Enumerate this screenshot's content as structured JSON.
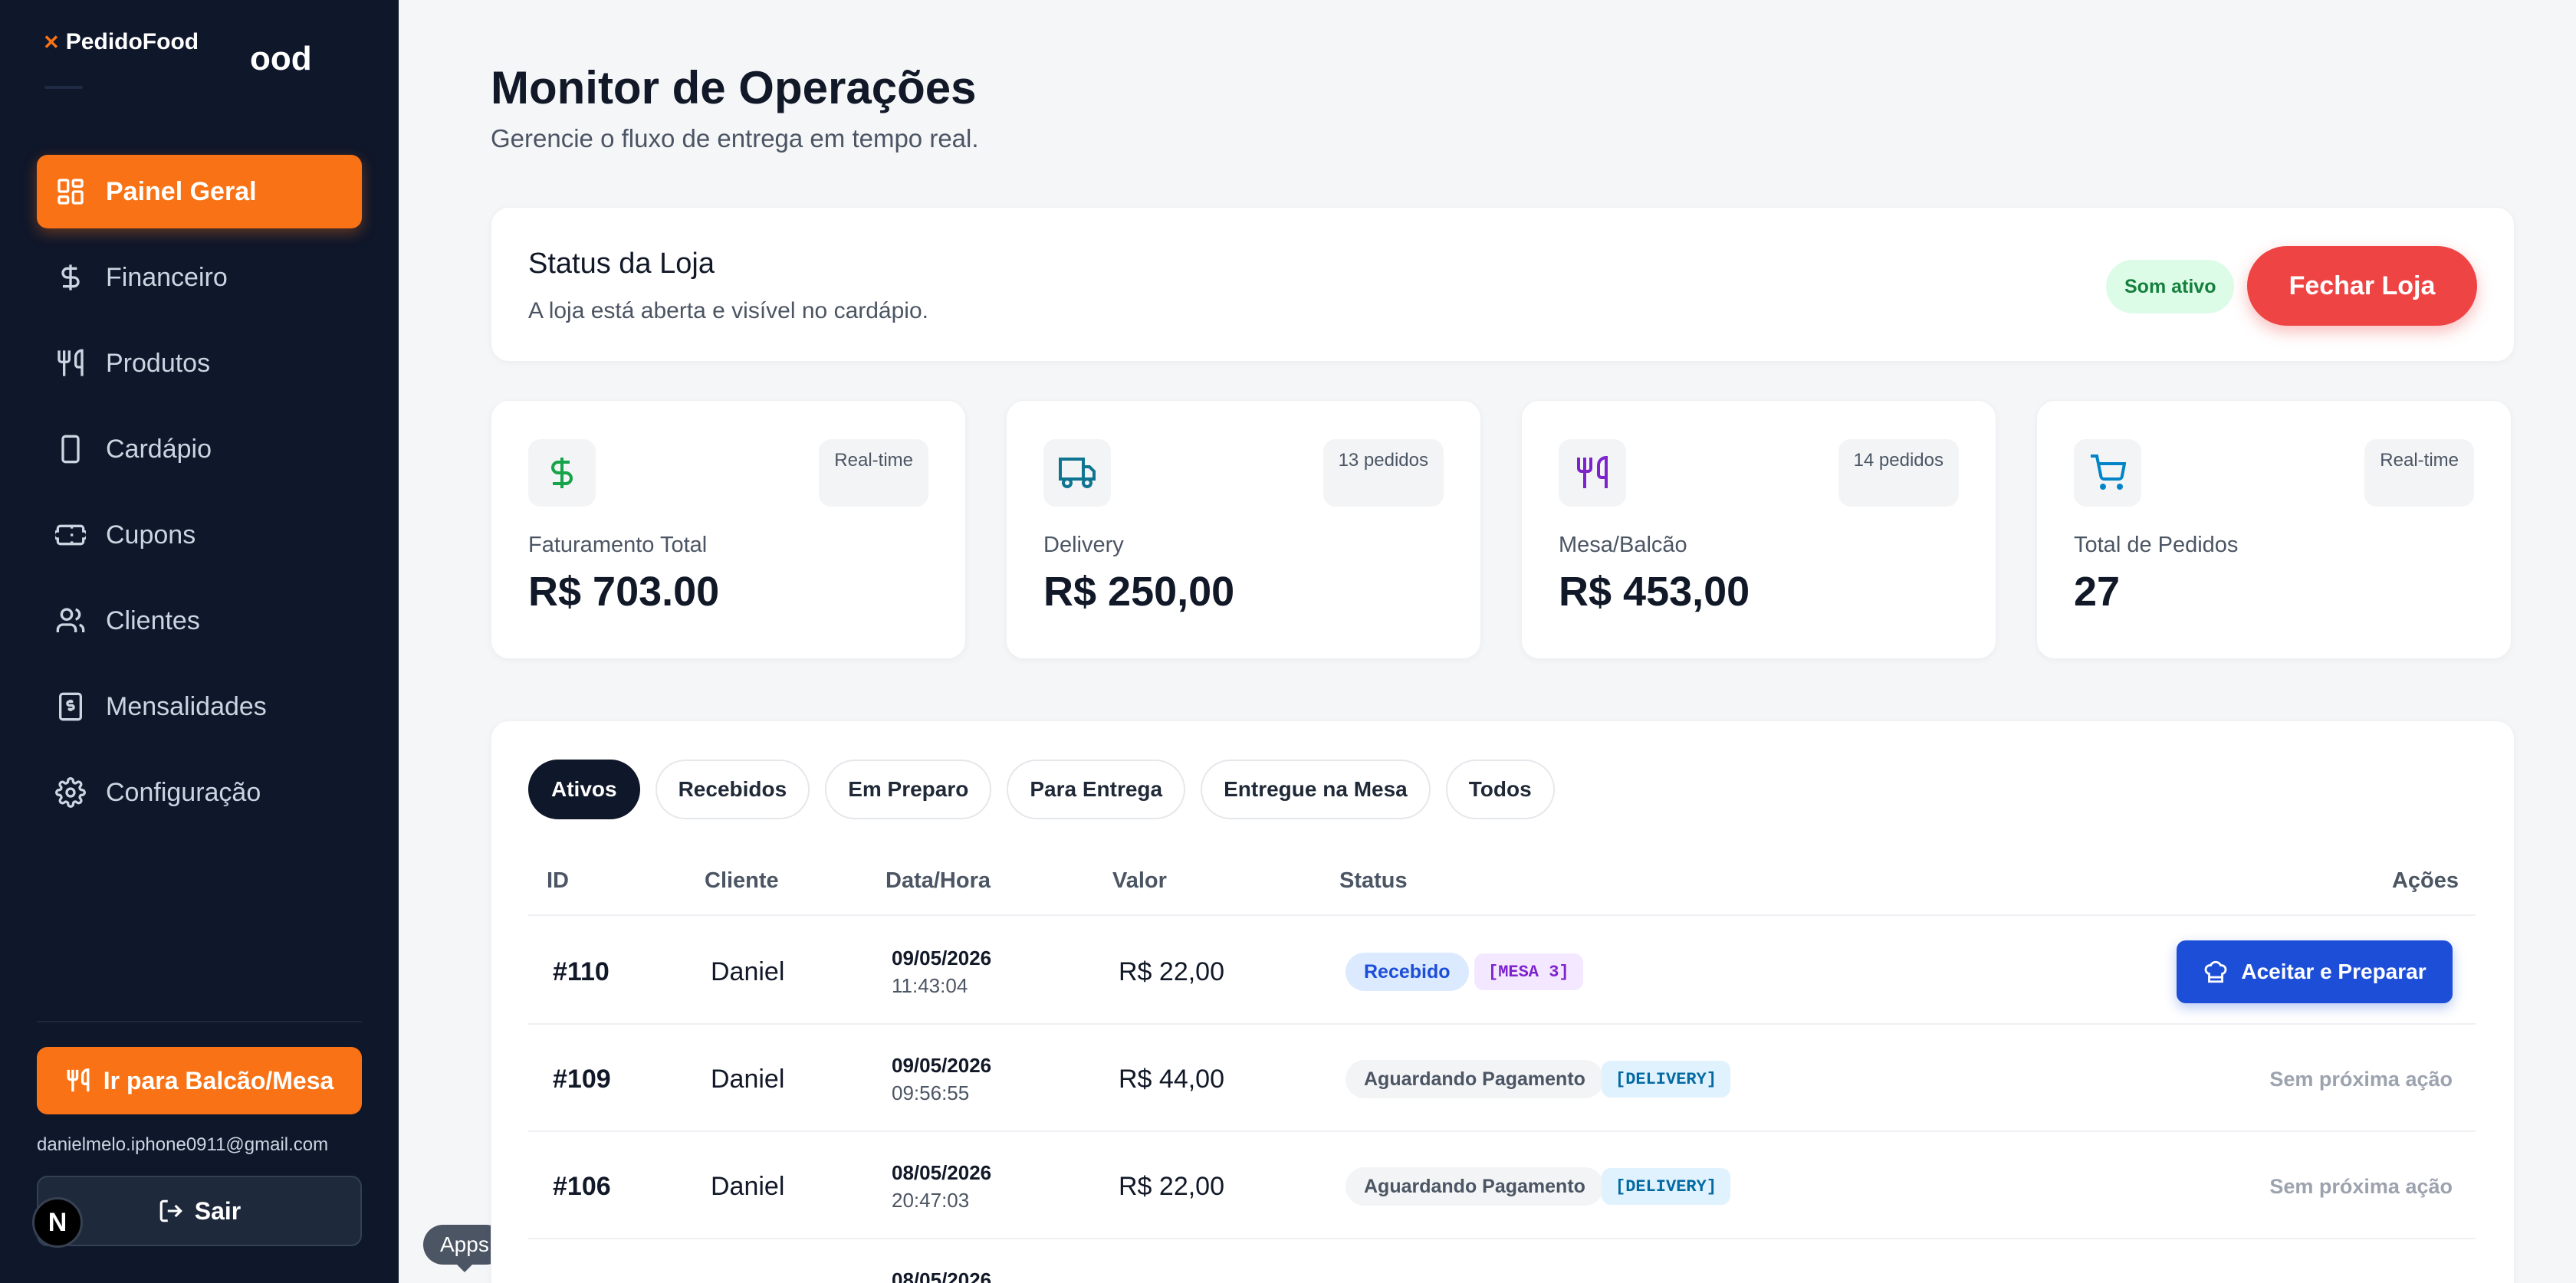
{
  "sidebar": {
    "brand": "PedidoFood",
    "brand_echo": "ood",
    "nav": [
      {
        "label": "Painel Geral",
        "icon": "dashboard-icon",
        "active": true
      },
      {
        "label": "Financeiro",
        "icon": "dollar-icon"
      },
      {
        "label": "Produtos",
        "icon": "utensils-icon"
      },
      {
        "label": "Cardápio",
        "icon": "phone-icon"
      },
      {
        "label": "Cupons",
        "icon": "ticket-icon"
      },
      {
        "label": "Clientes",
        "icon": "users-icon"
      },
      {
        "label": "Mensalidades",
        "icon": "receipt-icon"
      },
      {
        "label": "Configuração",
        "icon": "gear-icon"
      }
    ],
    "balcao_button": "Ir para Balcão/Mesa",
    "email": "danielmelo.iphone0911@gmail.com",
    "logout_button": "Sair",
    "n_badge": "N",
    "apps_tooltip": "Apps"
  },
  "header": {
    "title": "Monitor de Operações",
    "subtitle": "Gerencie o fluxo de entrega em tempo real."
  },
  "store_status": {
    "title": "Status da Loja",
    "description": "A loja está aberta e visível no cardápio.",
    "sound_badge": "Som ativo",
    "close_button": "Fechar Loja"
  },
  "stats": [
    {
      "label": "Faturamento Total",
      "value": "R$ 703.00",
      "badge": "Real-time",
      "icon": "dollar-icon"
    },
    {
      "label": "Delivery",
      "value": "R$ 250,00",
      "badge": "13 pedidos",
      "icon": "truck-icon"
    },
    {
      "label": "Mesa/Balcão",
      "value": "R$ 453,00",
      "badge": "14 pedidos",
      "icon": "utensils-icon"
    },
    {
      "label": "Total de Pedidos",
      "value": "27",
      "badge": "Real-time",
      "icon": "cart-icon"
    }
  ],
  "orders": {
    "tabs": [
      "Ativos",
      "Recebidos",
      "Em Preparo",
      "Para Entrega",
      "Entregue na Mesa",
      "Todos"
    ],
    "columns": [
      "ID",
      "Cliente",
      "Data/Hora",
      "Valor",
      "Status",
      "Ações"
    ],
    "rows": [
      {
        "id": "#110",
        "client": "Daniel",
        "date": "09/05/2026",
        "time": "11:43:04",
        "value": "R$ 22,00",
        "status": "Recebido",
        "tag": "[MESA 3]",
        "action": "Aceitar e Preparar"
      },
      {
        "id": "#109",
        "client": "Daniel",
        "date": "09/05/2026",
        "time": "09:56:55",
        "value": "R$ 44,00",
        "status": "Aguardando Pagamento",
        "tag": "[DELIVERY]",
        "action": "Sem próxima ação"
      },
      {
        "id": "#106",
        "client": "Daniel",
        "date": "08/05/2026",
        "time": "20:47:03",
        "value": "R$ 22,00",
        "status": "Aguardando Pagamento",
        "tag": "[DELIVERY]",
        "action": "Sem próxima ação"
      },
      {
        "date": "08/05/2026"
      }
    ]
  },
  "colors": {
    "accent": "#f97316",
    "sidebar_bg": "#0f172a",
    "danger": "#ef4444",
    "primary": "#1d4ed8",
    "success": "#15803d"
  }
}
